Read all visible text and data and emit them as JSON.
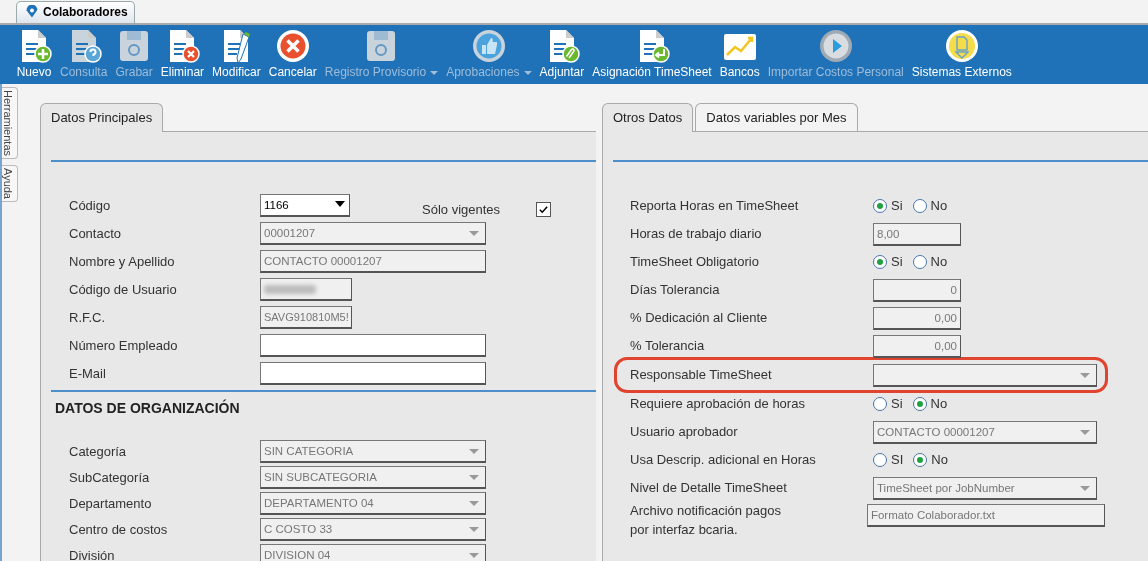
{
  "window_tab": {
    "title": "Colaboradores"
  },
  "side_tabs": [
    "Herramientas",
    "Ayuda"
  ],
  "toolbar": [
    {
      "label": "Nuevo",
      "kind": "doc-plus",
      "disabled": false,
      "has_menu": false
    },
    {
      "label": "Consulta",
      "kind": "doc-question",
      "disabled": true,
      "has_menu": false
    },
    {
      "label": "Grabar",
      "kind": "floppy",
      "disabled": true,
      "has_menu": false
    },
    {
      "label": "Eliminar",
      "kind": "doc-x",
      "disabled": false,
      "has_menu": false
    },
    {
      "label": "Modificar",
      "kind": "doc-pencil",
      "disabled": false,
      "has_menu": false
    },
    {
      "label": "Cancelar",
      "kind": "cancel",
      "disabled": false,
      "has_menu": false
    },
    {
      "label": "Registro Provisorio",
      "kind": "floppy",
      "disabled": true,
      "has_menu": true
    },
    {
      "label": "Aprobaciones",
      "kind": "thumb",
      "disabled": true,
      "has_menu": true
    },
    {
      "label": "Adjuntar",
      "kind": "doc-clip",
      "disabled": false,
      "has_menu": false
    },
    {
      "label": "Asignación TimeSheet",
      "kind": "doc-enter",
      "disabled": false,
      "has_menu": false
    },
    {
      "label": "Bancos",
      "kind": "chart",
      "disabled": false,
      "has_menu": false
    },
    {
      "label": "Importar Costos Personal",
      "kind": "play",
      "disabled": true,
      "has_menu": false
    },
    {
      "label": "Sistemas Externos",
      "kind": "external",
      "disabled": false,
      "has_menu": false
    }
  ],
  "left_panel": {
    "tabs": [
      {
        "label": "Datos Principales",
        "selected": true
      }
    ],
    "fields": [
      {
        "label": "Código",
        "kind": "code-combo",
        "value": "1166",
        "disabled": false
      },
      {
        "label": "Contacto",
        "kind": "combo",
        "value": "00001207",
        "disabled": true
      },
      {
        "label": "Nombre y Apellido",
        "kind": "text",
        "value": "CONTACTO 00001207",
        "disabled": true
      },
      {
        "label": "Código de Usuario",
        "kind": "redacted",
        "disabled": true
      },
      {
        "label": "R.F.C.",
        "kind": "short-text",
        "value": "SAVG910810M5!",
        "disabled": true
      },
      {
        "label": "Número Empleado",
        "kind": "text",
        "disabled": false
      },
      {
        "label": "E-Mail",
        "kind": "text",
        "disabled": false
      }
    ],
    "only_current": {
      "label": "Sólo vigentes",
      "checked": true
    },
    "section_title": "DATOS DE ORGANIZACIÓN",
    "org_fields": [
      {
        "label": "Categoría",
        "kind": "combo",
        "value": "SIN CATEGORIA",
        "disabled": true
      },
      {
        "label": "SubCategoría",
        "kind": "combo",
        "value": "SIN SUBCATEGORIA",
        "disabled": true
      },
      {
        "label": "Departamento",
        "kind": "combo",
        "value": "DEPARTAMENTO 04",
        "disabled": true
      },
      {
        "label": "Centro de costos",
        "kind": "combo",
        "value": "C COSTO 33",
        "disabled": true
      },
      {
        "label": "División",
        "kind": "combo",
        "value": "DIVISION 04",
        "disabled": true
      }
    ]
  },
  "right_panel": {
    "tabs": [
      {
        "label": "Otros Datos",
        "selected": true
      },
      {
        "label": "Datos variables por Mes",
        "selected": false
      }
    ],
    "rows": [
      {
        "label": "Reporta Horas en TimeSheet",
        "kind": "radio",
        "highlighted": false,
        "options": [
          {
            "label": "Si",
            "selected": true
          },
          {
            "label": "No",
            "selected": false
          }
        ]
      },
      {
        "label": "Horas de trabajo diario",
        "kind": "hours",
        "value": "8,00",
        "highlighted": false
      },
      {
        "label": "TimeSheet Obligatorio",
        "kind": "radio",
        "highlighted": false,
        "options": [
          {
            "label": "Si",
            "selected": true
          },
          {
            "label": "No",
            "selected": false
          }
        ]
      },
      {
        "label": "Días Tolerancia",
        "kind": "number",
        "value": "0",
        "highlighted": false
      },
      {
        "label": "% Dedicación al Cliente",
        "kind": "number",
        "value": "0,00",
        "highlighted": false
      },
      {
        "label": "% Tolerancia",
        "kind": "number",
        "value": "0,00",
        "highlighted": false
      },
      {
        "label": "Responsable TimeSheet",
        "kind": "combo",
        "highlighted": true
      },
      {
        "label": "Requiere aprobación de horas",
        "kind": "radio",
        "highlighted": false,
        "options": [
          {
            "label": "Si",
            "selected": false
          },
          {
            "label": "No",
            "selected": true
          }
        ]
      },
      {
        "label": "Usuario aprobador",
        "kind": "combo",
        "value": "CONTACTO 00001207",
        "highlighted": false
      },
      {
        "label": "Usa Descrip. adicional en Horas",
        "kind": "radio",
        "highlighted": false,
        "options": [
          {
            "label": "SI",
            "selected": false
          },
          {
            "label": "No",
            "selected": true
          }
        ]
      },
      {
        "label": "Nivel de Detalle TimeSheet",
        "kind": "combo",
        "value": "TimeSheet por JobNumber",
        "highlighted": false
      },
      {
        "label": "Archivo notificación pagos\npor interfaz bcaria.",
        "kind": "wide-text",
        "value": "Formato Colaborador.txt",
        "highlighted": false
      }
    ]
  }
}
